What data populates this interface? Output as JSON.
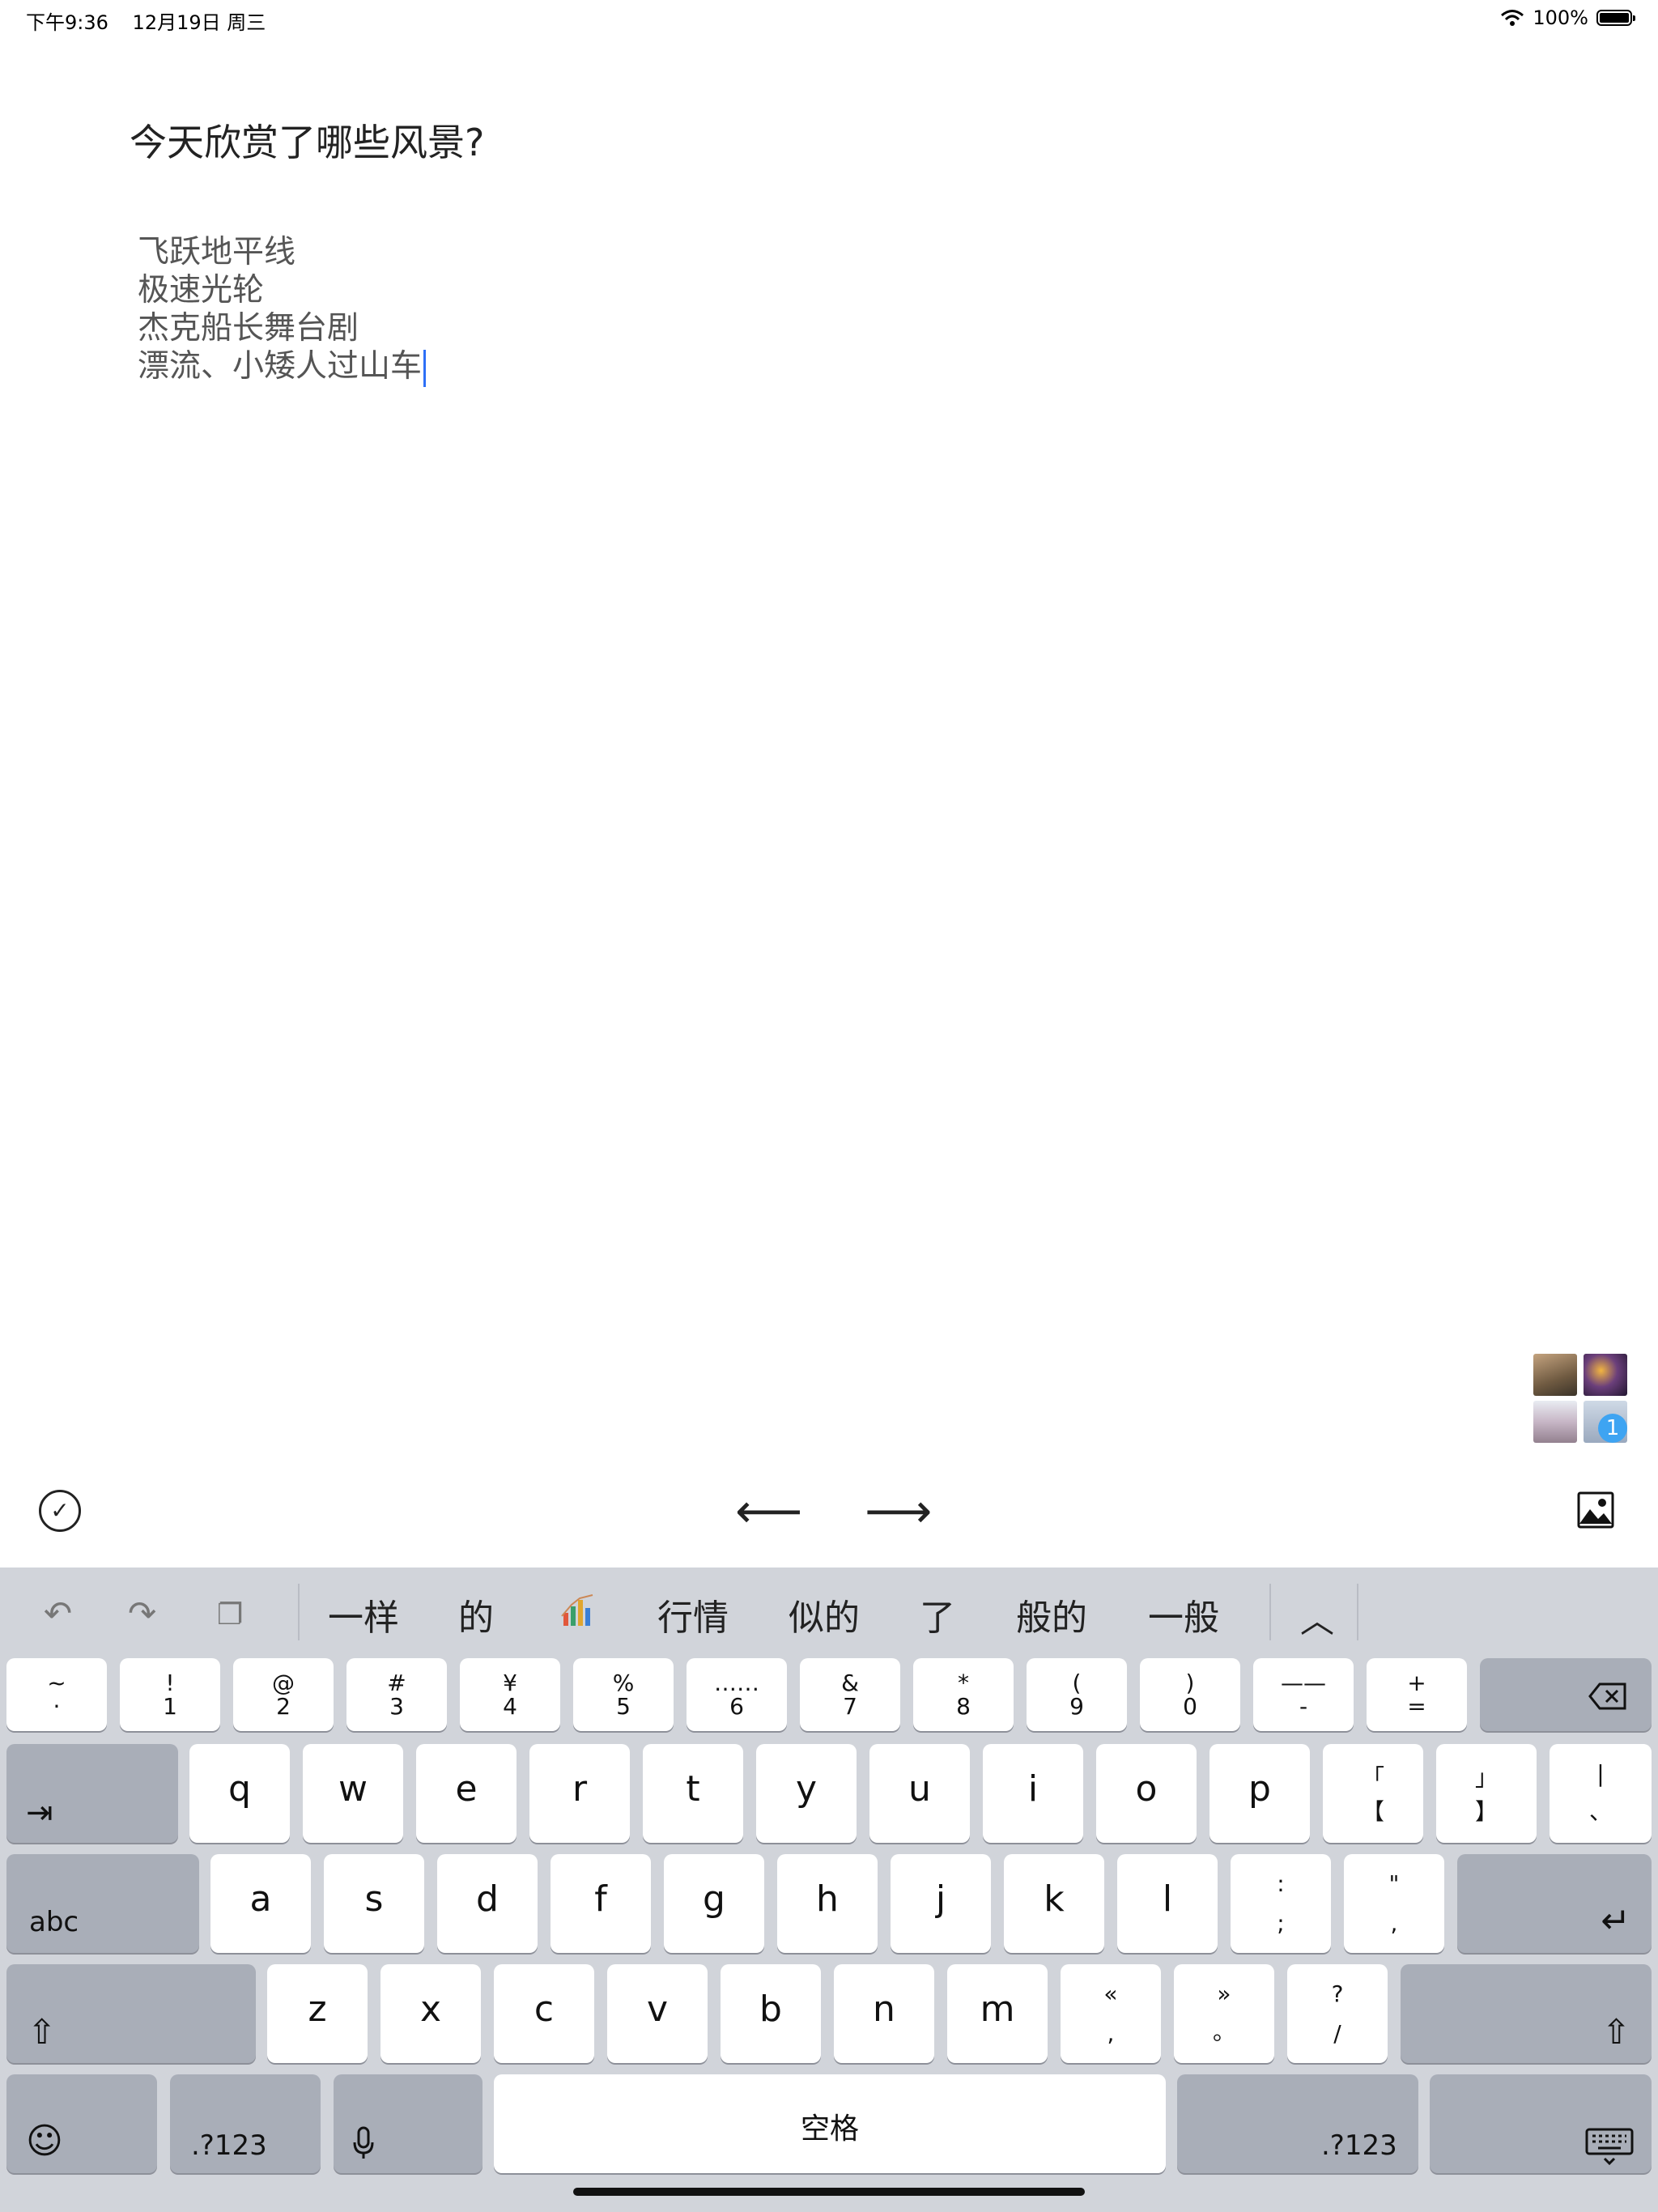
{
  "status_bar": {
    "time": "下午9:36",
    "date": "12月19日 周三",
    "battery": "100%"
  },
  "note": {
    "title": "今天欣赏了哪些风景?",
    "lines": [
      "飞跃地平线",
      "极速光轮",
      "杰克船长舞台剧",
      "漂流、小矮人过山车"
    ]
  },
  "gallery": {
    "badge": "1"
  },
  "toolbar": {
    "done_icon": "check-icon",
    "prev_icon": "arrow-left-icon",
    "next_icon": "arrow-right-icon",
    "image_icon": "image-icon"
  },
  "keyboard": {
    "candidates": [
      "一样",
      "的",
      "行情",
      "似的",
      "了",
      "般的",
      "一般"
    ],
    "number_row": [
      {
        "top": "~",
        "bottom": "·"
      },
      {
        "top": "!",
        "bottom": "1"
      },
      {
        "top": "@",
        "bottom": "2"
      },
      {
        "top": "#",
        "bottom": "3"
      },
      {
        "top": "¥",
        "bottom": "4"
      },
      {
        "top": "%",
        "bottom": "5"
      },
      {
        "top": "……",
        "bottom": "6"
      },
      {
        "top": "&",
        "bottom": "7"
      },
      {
        "top": "*",
        "bottom": "8"
      },
      {
        "top": "(",
        "bottom": "9"
      },
      {
        "top": ")",
        "bottom": "0"
      },
      {
        "top": "——",
        "bottom": "-"
      },
      {
        "top": "+",
        "bottom": "="
      }
    ],
    "row_q": [
      "q",
      "w",
      "e",
      "r",
      "t",
      "y",
      "u",
      "i",
      "o",
      "p"
    ],
    "row_q_extra": [
      {
        "top": "「",
        "bottom": "【"
      },
      {
        "top": "」",
        "bottom": "】"
      },
      {
        "top": "|",
        "bottom": "、"
      }
    ],
    "row_a": [
      "a",
      "s",
      "d",
      "f",
      "g",
      "h",
      "j",
      "k",
      "l"
    ],
    "row_a_extra": [
      {
        "top": ":",
        "bottom": ";"
      },
      {
        "top": "\"",
        "bottom": ","
      }
    ],
    "row_z": [
      "z",
      "x",
      "c",
      "v",
      "b",
      "n",
      "m"
    ],
    "row_z_extra": [
      {
        "top": "«",
        "bottom": ","
      },
      {
        "top": "»",
        "bottom": "。"
      },
      {
        "top": "?",
        "bottom": "/"
      }
    ],
    "abc_label": "abc",
    "numbers_label": ".?123",
    "space_label": "空格"
  }
}
